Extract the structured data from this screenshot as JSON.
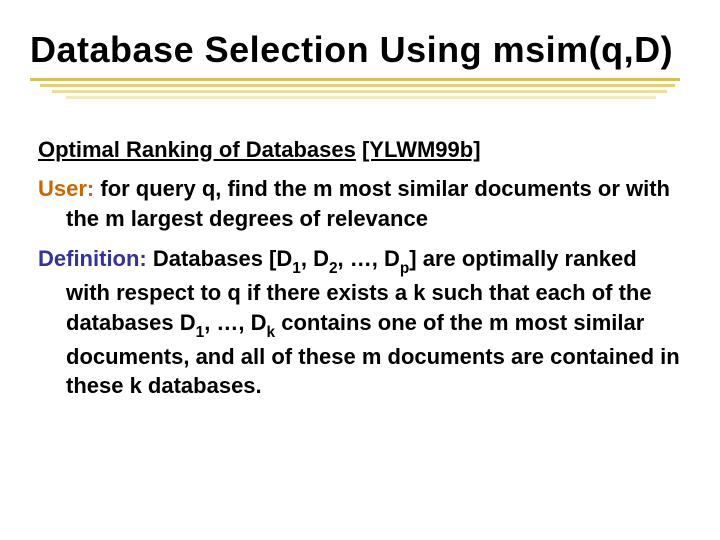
{
  "slide": {
    "title": "Database Selection Using msim(q,D)",
    "section_label": "Optimal Ranking of Databases",
    "section_ref": "[YLWM99b]",
    "user_label": "User:",
    "user_text": " for query q, find the m most similar documents or with the m largest degrees of relevance",
    "def_label": "Definition:",
    "def_lead": " Databases [D",
    "def_s1": "1",
    "def_c1": ", D",
    "def_s2": "2",
    "def_c2": ", …, D",
    "def_s3": "p",
    "def_c3": "] are optimally ranked with respect to q if there exists a k such that each of the databases D",
    "def_s4": "1",
    "def_c4": ", …, D",
    "def_s5": "k",
    "def_c5": " contains one of the m most similar documents, and all of these m documents are contained in these k databases."
  }
}
